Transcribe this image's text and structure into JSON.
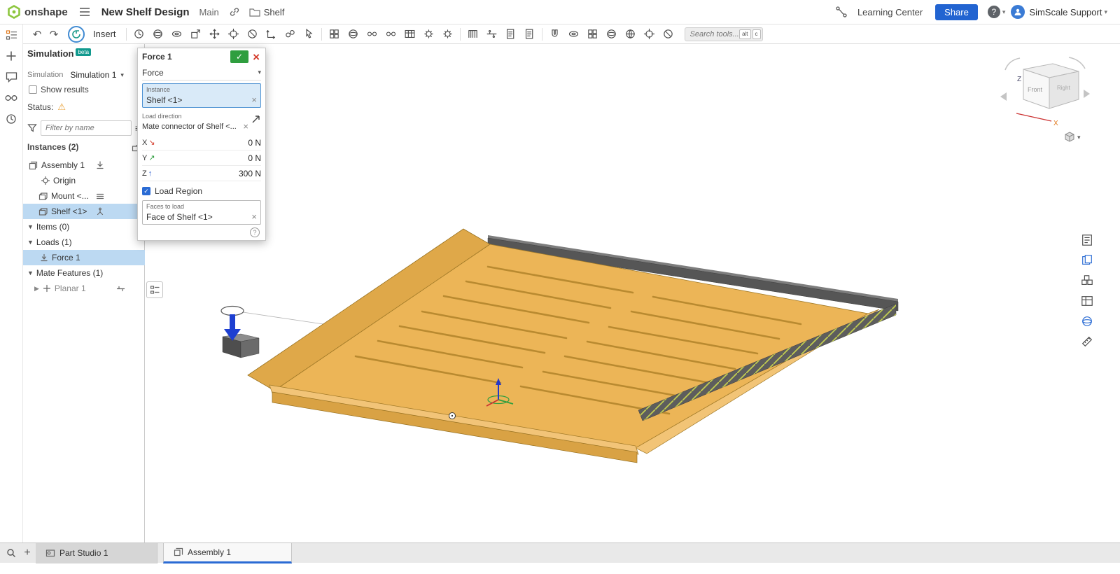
{
  "topbar": {
    "logo_text": "onshape",
    "doc_title": "New Shelf Design",
    "workspace": "Main",
    "folder_name": "Shelf",
    "learning_center": "Learning Center",
    "share_label": "Share",
    "user_name": "SimScale Support"
  },
  "toolbar": {
    "insert_label": "Insert",
    "search_placeholder": "Search tools...",
    "key1": "alt",
    "key2": "c",
    "icons": [
      "mass-properties-icon",
      "sphere-icon",
      "revolute-icon",
      "insert-icon",
      "move-icon",
      "mate-connector-icon",
      "suppress-icon",
      "axes-icon",
      "ball-mate-icon",
      "select-icon",
      "pattern-icon",
      "spherical-mate-icon",
      "cylindrical-mate-icon",
      "parallel-mate-icon",
      "bom-table-icon",
      "gear-relation-icon",
      "rack-relation-icon",
      "belt-icon",
      "slider-mate-icon",
      "drawing-icon",
      "sheet-icon",
      "magnet-icon",
      "ring-icon",
      "faces-icon",
      "loop-icon",
      "mesh-icon",
      "measure-icon",
      "section-icon"
    ]
  },
  "rail": {
    "icons": [
      "feature-list-icon",
      "add-icon",
      "comments-icon",
      "follow-mode-icon",
      "history-icon"
    ],
    "bottom_icon": "search-icon"
  },
  "sidebar": {
    "title": "Simulation",
    "beta": "beta",
    "simulation_label": "Simulation",
    "simulation_value": "Simulation 1",
    "show_results": "Show results",
    "status_label": "Status:",
    "filter_placeholder": "Filter by name",
    "instances_header": "Instances (2)",
    "assembly": "Assembly 1",
    "origin": "Origin",
    "mount": "Mount <...",
    "shelf": "Shelf <1>",
    "items_header": "Items (0)",
    "loads_header": "Loads (1)",
    "force": "Force 1",
    "mate_header": "Mate Features (1)",
    "planar": "Planar 1"
  },
  "dialog": {
    "title": "Force 1",
    "type_value": "Force",
    "instance_label": "Instance",
    "instance_value": "Shelf <1>",
    "direction_label": "Load direction",
    "direction_value": "Mate connector of Shelf <...",
    "x_label": "X",
    "x_value": "0 N",
    "y_label": "Y",
    "y_value": "0 N",
    "z_label": "Z",
    "z_value": "300 N",
    "load_region": "Load Region",
    "faces_label": "Faces to load",
    "faces_value": "Face of Shelf <1>"
  },
  "viewcube": {
    "front": "Front",
    "right": "Right",
    "z": "Z",
    "x": "X"
  },
  "tabs": {
    "part_studio": "Part Studio 1",
    "assembly": "Assembly 1"
  },
  "colors": {
    "accent_blue": "#2264d1",
    "selection_blue": "#bcd9f2",
    "onshape_green": "#8dc63f",
    "confirm_green": "#2f9e3f",
    "cancel_red": "#d43c2c",
    "shelf_orange": "#ecb557",
    "rail_gray": "#565656",
    "hatch_yellow": "#cdd94e",
    "force_arrow_blue": "#1d3fd1"
  }
}
